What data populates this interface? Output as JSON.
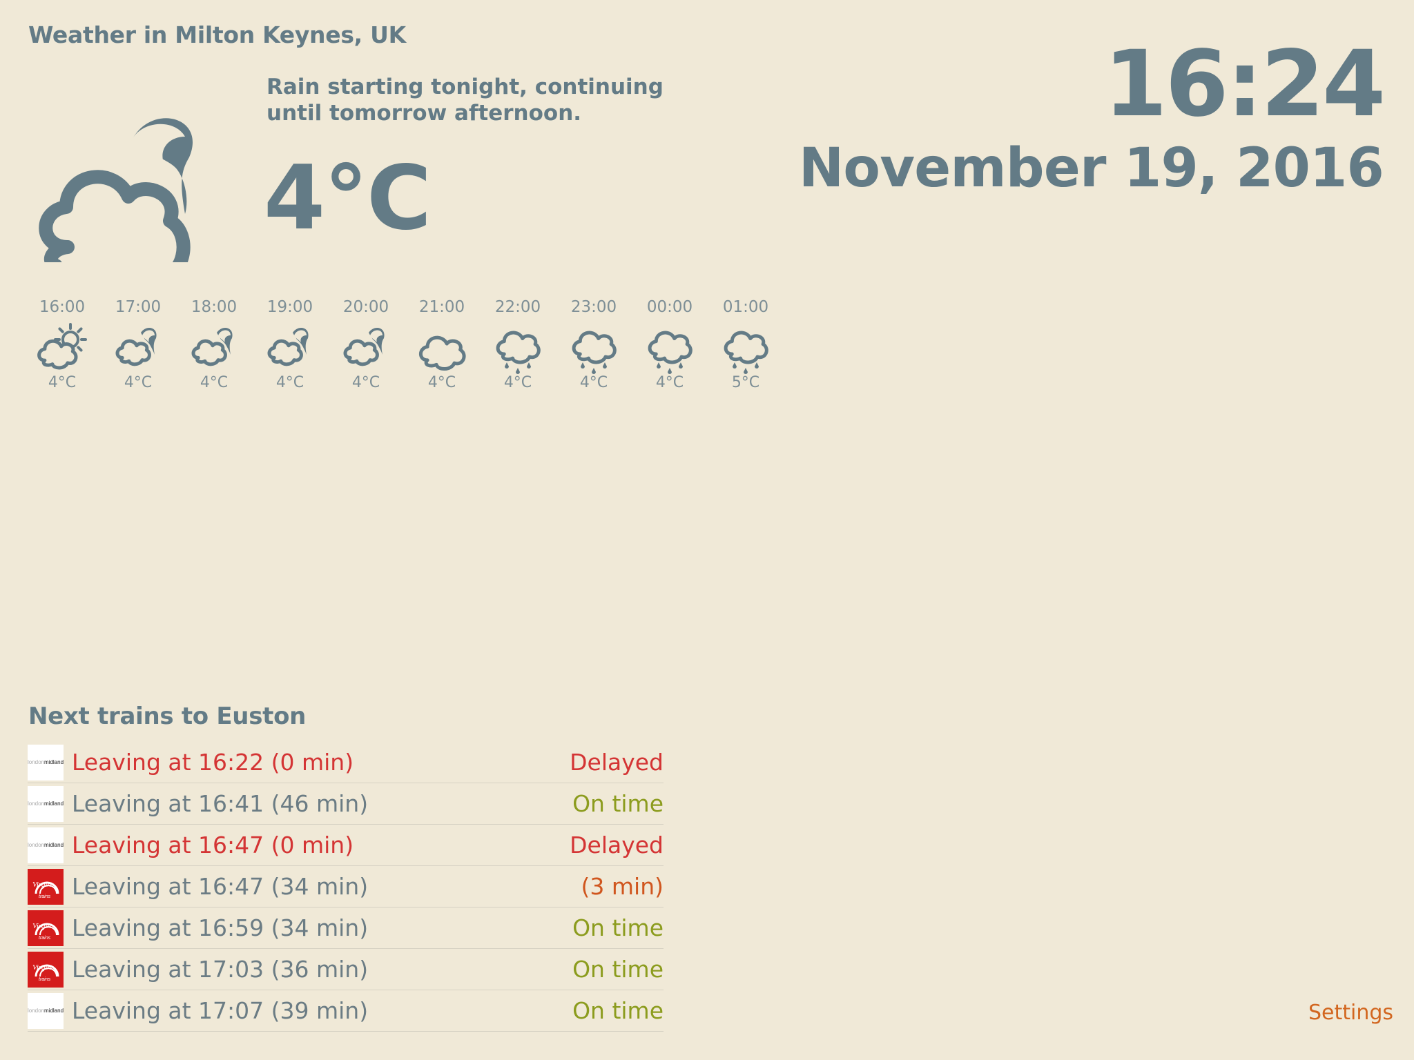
{
  "weather": {
    "location_title": "Weather in Milton Keynes, UK",
    "summary": "Rain starting tonight, continuing until tomorrow afternoon.",
    "current_temp": "4°C",
    "current_icon": "partly-cloudy-night-icon"
  },
  "clock": {
    "time": "16:24",
    "date": "November 19, 2016"
  },
  "hourly": [
    {
      "time": "16:00",
      "temp": "4°C",
      "icon": "partly-cloudy-day-icon"
    },
    {
      "time": "17:00",
      "temp": "4°C",
      "icon": "partly-cloudy-night-icon"
    },
    {
      "time": "18:00",
      "temp": "4°C",
      "icon": "partly-cloudy-night-icon"
    },
    {
      "time": "19:00",
      "temp": "4°C",
      "icon": "partly-cloudy-night-icon"
    },
    {
      "time": "20:00",
      "temp": "4°C",
      "icon": "partly-cloudy-night-icon"
    },
    {
      "time": "21:00",
      "temp": "4°C",
      "icon": "cloudy-icon"
    },
    {
      "time": "22:00",
      "temp": "4°C",
      "icon": "rain-icon"
    },
    {
      "time": "23:00",
      "temp": "4°C",
      "icon": "rain-icon"
    },
    {
      "time": "00:00",
      "temp": "4°C",
      "icon": "rain-icon"
    },
    {
      "time": "01:00",
      "temp": "5°C",
      "icon": "rain-icon"
    }
  ],
  "trains": {
    "title": "Next trains to Euston",
    "rows": [
      {
        "operator": "london-midland",
        "text": "Leaving at 16:22 (0 min)",
        "status": "Delayed",
        "state": "delayed"
      },
      {
        "operator": "london-midland",
        "text": "Leaving at 16:41 (46 min)",
        "status": "On time",
        "state": "ontime"
      },
      {
        "operator": "london-midland",
        "text": "Leaving at 16:47 (0 min)",
        "status": "Delayed",
        "state": "delayed"
      },
      {
        "operator": "virgin-trains",
        "text": "Leaving at 16:47 (34 min)",
        "status": "(3 min)",
        "state": "late"
      },
      {
        "operator": "virgin-trains",
        "text": "Leaving at 16:59 (34 min)",
        "status": "On time",
        "state": "ontime"
      },
      {
        "operator": "virgin-trains",
        "text": "Leaving at 17:03 (36 min)",
        "status": "On time",
        "state": "ontime"
      },
      {
        "operator": "london-midland",
        "text": "Leaving at 17:07 (39 min)",
        "status": "On time",
        "state": "ontime"
      }
    ]
  },
  "settings_label": "Settings",
  "colors": {
    "background": "#f0e9d7",
    "text": "#637b86",
    "delayed": "#d43434",
    "ontime": "#8c9c1e",
    "late": "#d0561e",
    "settings": "#d2661f"
  }
}
